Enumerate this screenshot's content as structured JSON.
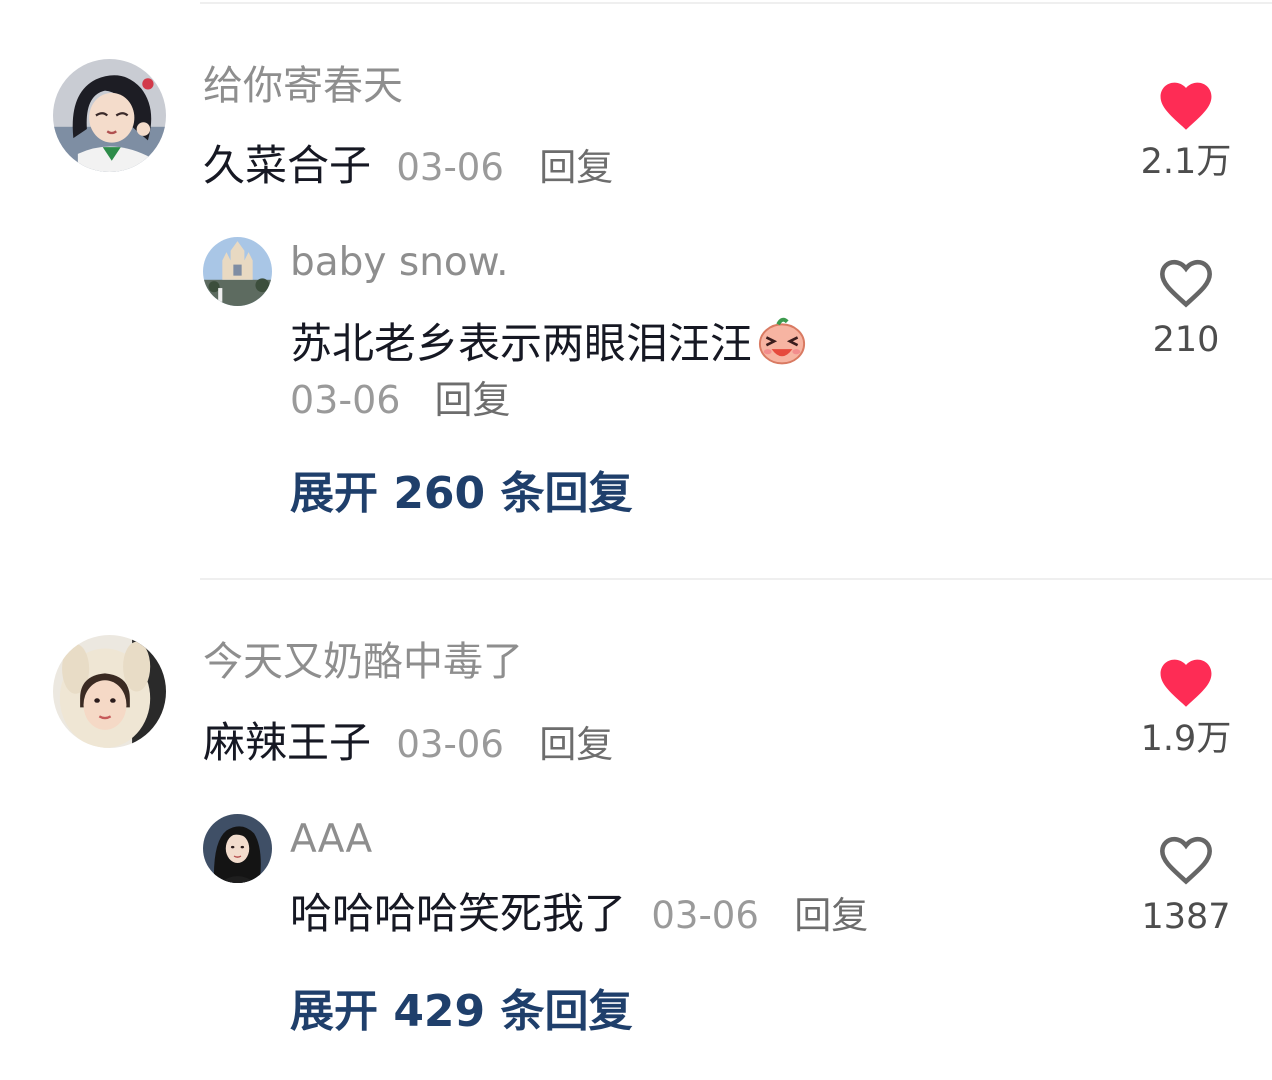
{
  "colors": {
    "liked_heart": "#fe2c55",
    "unliked_heart": "#666666",
    "expand_link": "#1f3f6b",
    "nickname": "#8e8e8e",
    "content": "#161823"
  },
  "comments": [
    {
      "nickname": "给你寄春天",
      "text": "久菜合子",
      "date": "03-06",
      "reply_label": "回复",
      "likes": "2.1万",
      "liked": true,
      "sub_reply": {
        "nickname": "baby snow.",
        "text": "苏北老乡表示两眼泪汪汪",
        "emoji_icon": "laughing-crying-emoji-icon",
        "date": "03-06",
        "reply_label": "回复",
        "likes": "210",
        "liked": false
      },
      "expand_label": "展开 260 条回复"
    },
    {
      "nickname": "今天又奶酪中毒了",
      "text": "麻辣王子",
      "date": "03-06",
      "reply_label": "回复",
      "likes": "1.9万",
      "liked": true,
      "sub_reply": {
        "nickname": "AAA",
        "text": "哈哈哈哈笑死我了",
        "date": "03-06",
        "reply_label": "回复",
        "likes": "1387",
        "liked": false
      },
      "expand_label": "展开 429 条回复"
    }
  ]
}
